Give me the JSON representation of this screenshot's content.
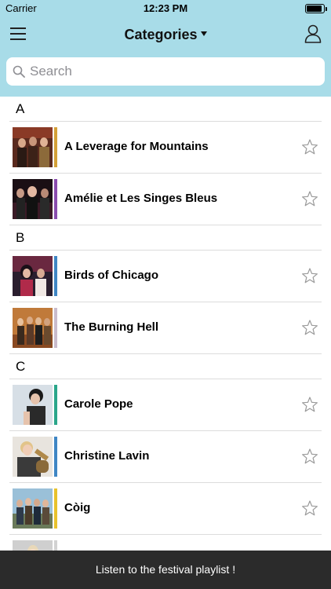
{
  "status_bar": {
    "carrier": "Carrier",
    "time": "12:23 PM",
    "battery_level": 0.9
  },
  "nav": {
    "title": "Categories",
    "menu_icon": "hamburger-menu-icon",
    "title_icon": "caret-down-icon",
    "user_icon": "user-profile-icon"
  },
  "search": {
    "placeholder": "Search",
    "value": "",
    "icon": "search-icon"
  },
  "colors": {
    "nav_background": "#a8dce8",
    "bottom_bar_background": "#2b2b2b",
    "star_outline": "#9a9a9a"
  },
  "list": {
    "sections": [
      {
        "letter": "A",
        "items": [
          {
            "name": "A Leverage for Mountains",
            "color": "#d4a037",
            "favorite": false,
            "star_icon": "star-outline-icon"
          },
          {
            "name": "Amélie et Les Singes Bleus",
            "color": "#8a4cae",
            "favorite": false,
            "star_icon": "star-outline-icon"
          }
        ]
      },
      {
        "letter": "B",
        "items": [
          {
            "name": "Birds of Chicago",
            "color": "#3f86c4",
            "favorite": false,
            "star_icon": "star-outline-icon"
          },
          {
            "name": "The Burning Hell",
            "color": "#c9bccc",
            "favorite": false,
            "star_icon": "star-outline-icon"
          }
        ]
      },
      {
        "letter": "C",
        "items": [
          {
            "name": "Carole Pope",
            "color": "#2aa68a",
            "favorite": false,
            "star_icon": "star-outline-icon"
          },
          {
            "name": "Christine Lavin",
            "color": "#3f86c4",
            "favorite": false,
            "star_icon": "star-outline-icon"
          },
          {
            "name": "Còig",
            "color": "#e8c22c",
            "favorite": false,
            "star_icon": "star-outline-icon"
          }
        ]
      }
    ]
  },
  "bottom_bar": {
    "label": "Listen to the festival playlist !"
  }
}
